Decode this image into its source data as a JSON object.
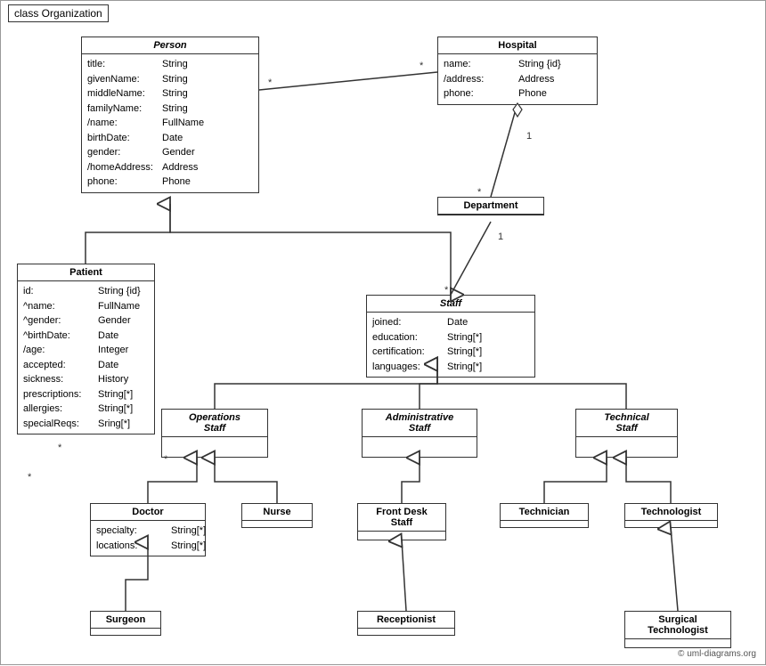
{
  "title": "class Organization",
  "copyright": "© uml-diagrams.org",
  "classes": {
    "person": {
      "name": "Person",
      "italic": true,
      "attrs": [
        {
          "name": "title:",
          "type": "String"
        },
        {
          "name": "givenName:",
          "type": "String"
        },
        {
          "name": "middleName:",
          "type": "String"
        },
        {
          "name": "familyName:",
          "type": "String"
        },
        {
          "name": "/name:",
          "type": "FullName"
        },
        {
          "name": "birthDate:",
          "type": "Date"
        },
        {
          "name": "gender:",
          "type": "Gender"
        },
        {
          "name": "/homeAddress:",
          "type": "Address"
        },
        {
          "name": "phone:",
          "type": "Phone"
        }
      ]
    },
    "hospital": {
      "name": "Hospital",
      "italic": false,
      "attrs": [
        {
          "name": "name:",
          "type": "String {id}"
        },
        {
          "name": "/address:",
          "type": "Address"
        },
        {
          "name": "phone:",
          "type": "Phone"
        }
      ]
    },
    "department": {
      "name": "Department",
      "italic": false,
      "attrs": []
    },
    "staff": {
      "name": "Staff",
      "italic": true,
      "attrs": [
        {
          "name": "joined:",
          "type": "Date"
        },
        {
          "name": "education:",
          "type": "String[*]"
        },
        {
          "name": "certification:",
          "type": "String[*]"
        },
        {
          "name": "languages:",
          "type": "String[*]"
        }
      ]
    },
    "patient": {
      "name": "Patient",
      "italic": false,
      "attrs": [
        {
          "name": "id:",
          "type": "String {id}"
        },
        {
          "name": "^name:",
          "type": "FullName"
        },
        {
          "name": "^gender:",
          "type": "Gender"
        },
        {
          "name": "^birthDate:",
          "type": "Date"
        },
        {
          "name": "/age:",
          "type": "Integer"
        },
        {
          "name": "accepted:",
          "type": "Date"
        },
        {
          "name": "sickness:",
          "type": "History"
        },
        {
          "name": "prescriptions:",
          "type": "String[*]"
        },
        {
          "name": "allergies:",
          "type": "String[*]"
        },
        {
          "name": "specialReqs:",
          "type": "Sring[*]"
        }
      ]
    },
    "operations_staff": {
      "name": "Operations\nStaff",
      "italic": true,
      "attrs": []
    },
    "admin_staff": {
      "name": "Administrative\nStaff",
      "italic": true,
      "attrs": []
    },
    "technical_staff": {
      "name": "Technical\nStaff",
      "italic": true,
      "attrs": []
    },
    "doctor": {
      "name": "Doctor",
      "italic": false,
      "attrs": [
        {
          "name": "specialty:",
          "type": "String[*]"
        },
        {
          "name": "locations:",
          "type": "String[*]"
        }
      ]
    },
    "nurse": {
      "name": "Nurse",
      "italic": false,
      "attrs": []
    },
    "front_desk": {
      "name": "Front Desk\nStaff",
      "italic": false,
      "attrs": []
    },
    "technician": {
      "name": "Technician",
      "italic": false,
      "attrs": []
    },
    "technologist": {
      "name": "Technologist",
      "italic": false,
      "attrs": []
    },
    "surgeon": {
      "name": "Surgeon",
      "italic": false,
      "attrs": []
    },
    "receptionist": {
      "name": "Receptionist",
      "italic": false,
      "attrs": []
    },
    "surgical_technologist": {
      "name": "Surgical\nTechnologist",
      "italic": false,
      "attrs": []
    }
  }
}
